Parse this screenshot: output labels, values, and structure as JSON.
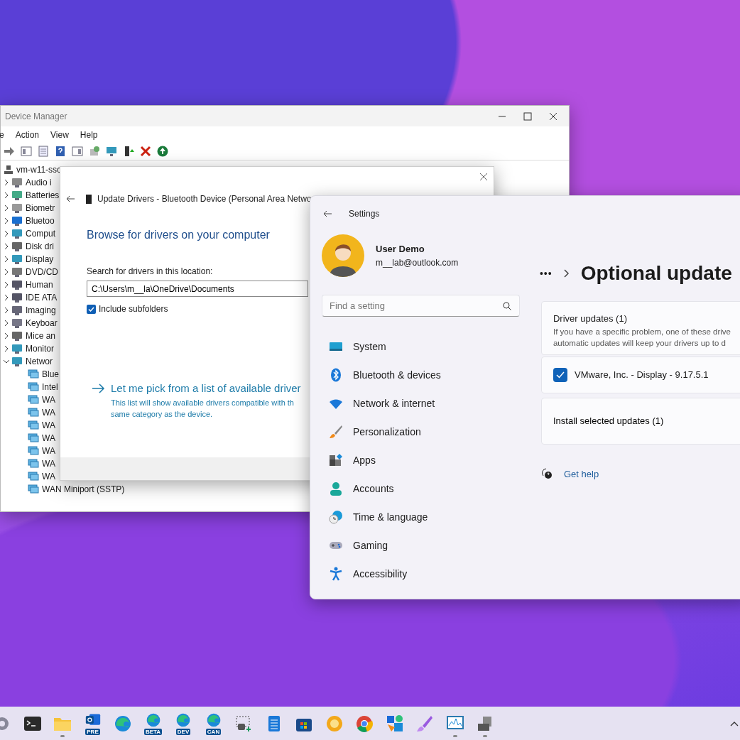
{
  "device_manager": {
    "title": "Device Manager",
    "menu": [
      "e",
      "Action",
      "View",
      "Help"
    ],
    "tree": {
      "label": "vm-w11-ssc",
      "children": [
        {
          "label": "Audio i",
          "expanded": false
        },
        {
          "label": "Batteries",
          "expanded": false
        },
        {
          "label": "Biometr",
          "expanded": false
        },
        {
          "label": "Bluetoo",
          "expanded": false
        },
        {
          "label": "Comput",
          "expanded": false
        },
        {
          "label": "Disk dri",
          "expanded": false
        },
        {
          "label": "Display",
          "expanded": false
        },
        {
          "label": "DVD/CD",
          "expanded": false
        },
        {
          "label": "Human",
          "expanded": false
        },
        {
          "label": "IDE ATA",
          "expanded": false
        },
        {
          "label": "Imaging",
          "expanded": false
        },
        {
          "label": "Keyboar",
          "expanded": false
        },
        {
          "label": "Mice an",
          "expanded": false
        },
        {
          "label": "Monitor",
          "expanded": false
        },
        {
          "label": "Networ",
          "expanded": true,
          "children": [
            {
              "label": "Blue"
            },
            {
              "label": "Intel"
            },
            {
              "label": "WA"
            },
            {
              "label": "WA"
            },
            {
              "label": "WA"
            },
            {
              "label": "WA"
            },
            {
              "label": "WA"
            },
            {
              "label": "WA"
            },
            {
              "label": "WA"
            },
            {
              "label": "WAN Miniport (SSTP)"
            }
          ]
        }
      ]
    }
  },
  "update_dialog": {
    "title": "Update Drivers - Bluetooth Device (Personal Area Netwo",
    "heading": "Browse for drivers on your computer",
    "location_label": "Search for drivers in this location:",
    "location_value": "C:\\Users\\m__la\\OneDrive\\Documents",
    "include_subfolders": {
      "label": "Include subfolders",
      "checked": true
    },
    "pick_link": "Let me pick from a list of available driver",
    "pick_description": [
      "This list will show available drivers compatible with th",
      "same category as the device."
    ]
  },
  "settings": {
    "title": "Settings",
    "user": {
      "name": "User Demo",
      "email": "m__lab@outlook.com"
    },
    "search": {
      "placeholder": "Find a setting"
    },
    "nav": [
      {
        "label": "System",
        "selected": false
      },
      {
        "label": "Bluetooth & devices",
        "selected": false
      },
      {
        "label": "Network & internet",
        "selected": false
      },
      {
        "label": "Personalization",
        "selected": false
      },
      {
        "label": "Apps",
        "selected": false
      },
      {
        "label": "Accounts",
        "selected": false
      },
      {
        "label": "Time & language",
        "selected": false
      },
      {
        "label": "Gaming",
        "selected": false
      },
      {
        "label": "Accessibility",
        "selected": false
      }
    ],
    "breadcrumb": {
      "more": "•••",
      "page": "Optional update"
    },
    "driver_updates": {
      "title": "Driver updates (1)",
      "description": [
        "If you have a specific problem, one of these drive",
        "automatic updates will keep your drivers up to d"
      ],
      "items": [
        {
          "label": "VMware, Inc. - Display - 9.17.5.1",
          "checked": true
        }
      ]
    },
    "install_button": "Install selected updates (1)",
    "get_help": "Get help"
  },
  "taskbar": {
    "apps": [
      {
        "kind": "gear",
        "running": false
      },
      {
        "kind": "terminal",
        "running": false
      },
      {
        "kind": "folder",
        "running": true
      },
      {
        "kind": "mail",
        "badge": "PRE",
        "running": false
      },
      {
        "kind": "edge",
        "running": false
      },
      {
        "kind": "edge",
        "badge": "BETA",
        "running": false
      },
      {
        "kind": "edge",
        "badge": "DEV",
        "running": false
      },
      {
        "kind": "edge",
        "badge": "CAN",
        "running": false
      },
      {
        "kind": "snip",
        "running": false
      },
      {
        "kind": "notepad",
        "running": false
      },
      {
        "kind": "store",
        "running": false
      },
      {
        "kind": "ring",
        "running": false
      },
      {
        "kind": "chrome",
        "running": false
      },
      {
        "kind": "tiles",
        "running": false
      },
      {
        "kind": "brush",
        "running": false
      },
      {
        "kind": "monitor",
        "running": true
      },
      {
        "kind": "device",
        "running": true
      }
    ]
  }
}
